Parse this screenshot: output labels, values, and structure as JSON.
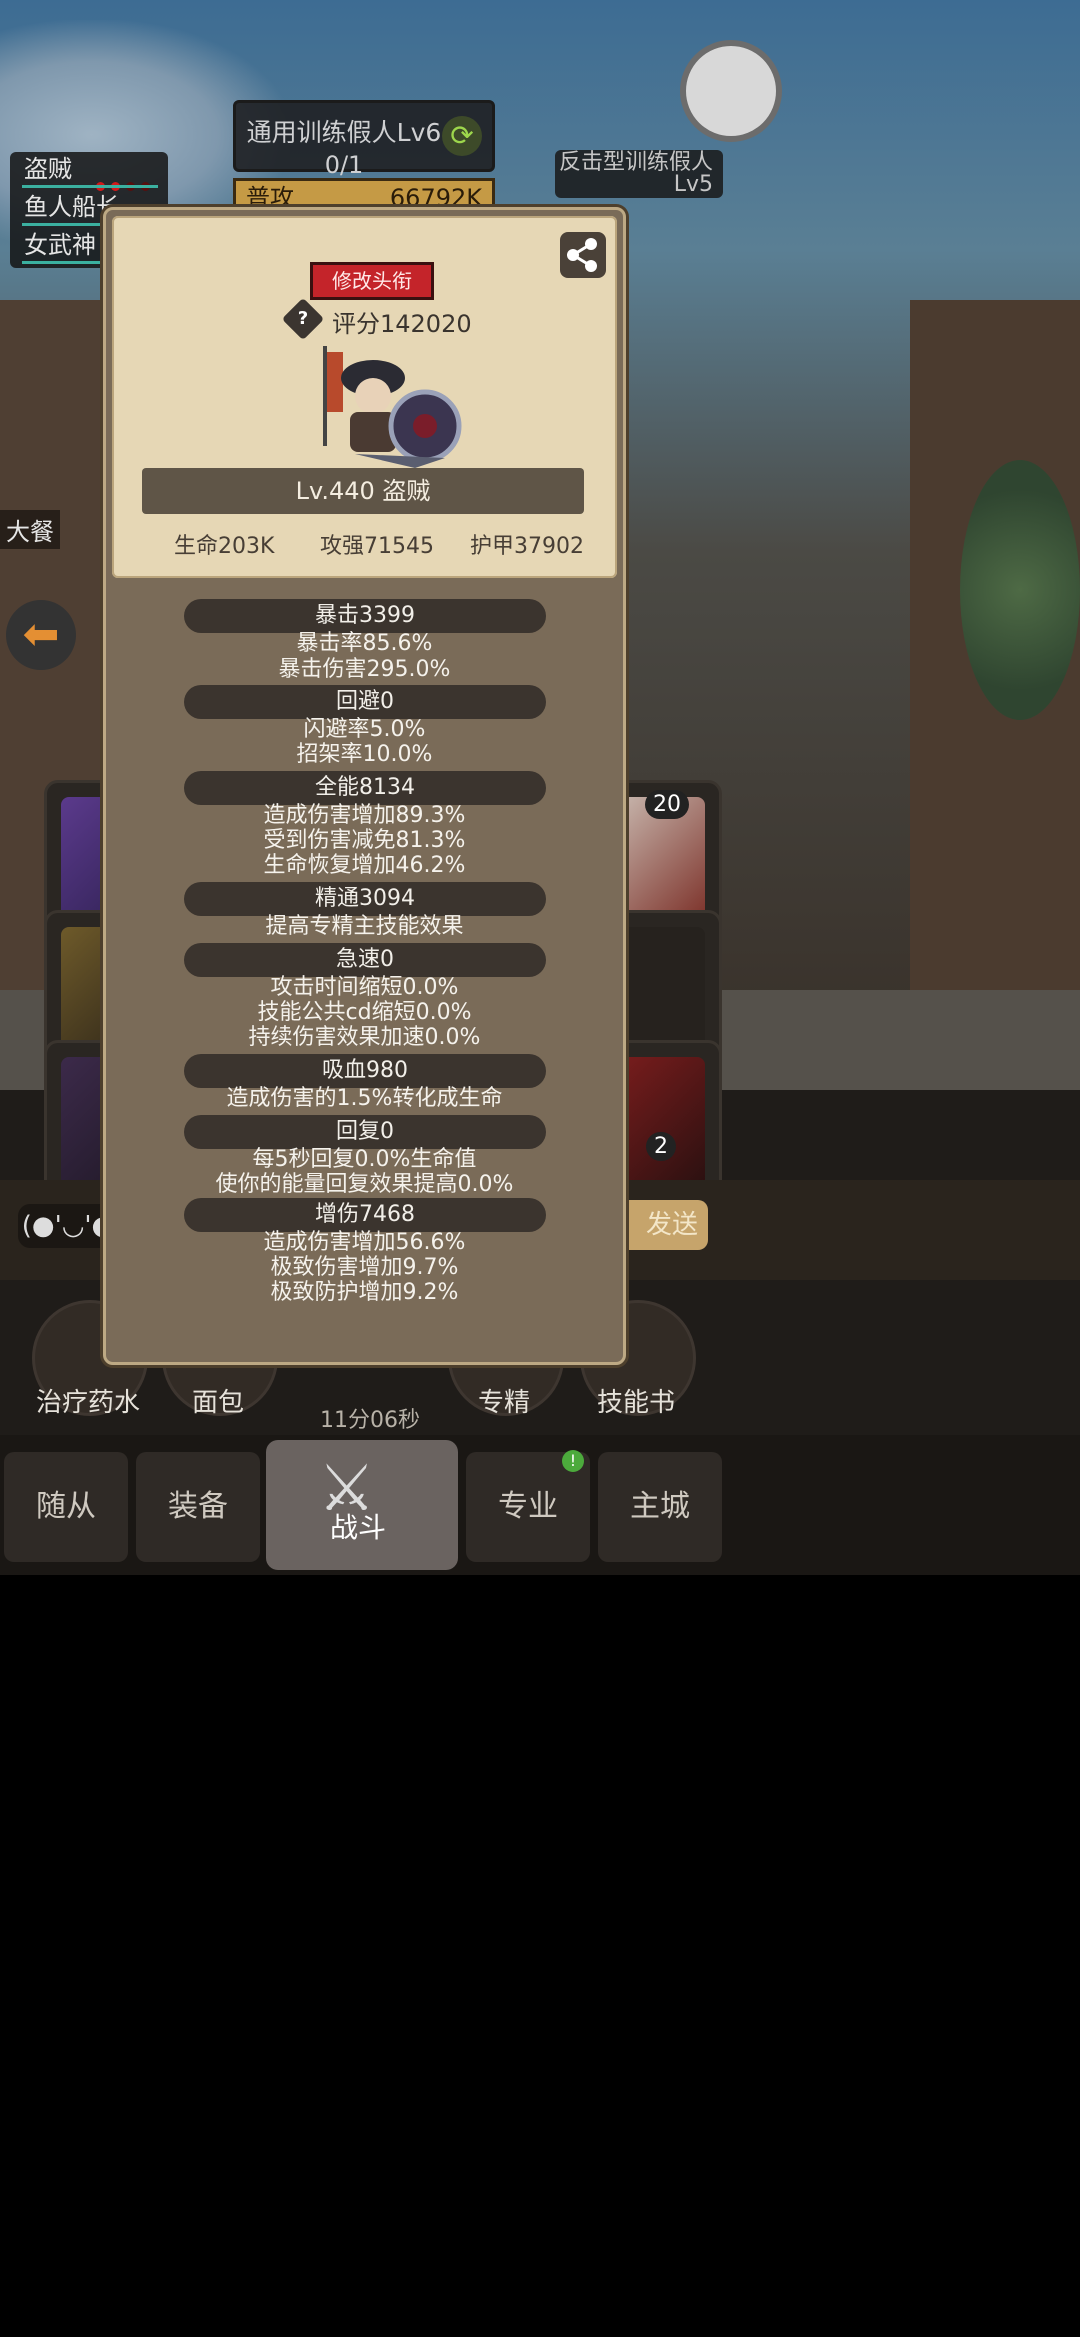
{
  "hud": {
    "target_name": "通用训练假人Lv6",
    "target_progress": "0/1",
    "attack_label": "普攻",
    "attack_value": "66792K",
    "right_target_line1": "反击型训练假人",
    "right_target_line2": "Lv5"
  },
  "party": [
    {
      "name": "盗贼"
    },
    {
      "name": "鱼人船长"
    },
    {
      "name": "女武神"
    }
  ],
  "side_label": "大餐",
  "modal": {
    "title_button": "修改头衔",
    "score": "评分142020",
    "level_name": "Lv.440 盗贼",
    "stats": {
      "hp": "生命203K",
      "attack": "攻强71545",
      "armor": "护甲37902"
    },
    "sections": [
      {
        "header": "暴击3399",
        "lines": [
          "暴击率85.6%",
          "暴击伤害295.0%"
        ]
      },
      {
        "header": "回避0",
        "lines": [
          "闪避率5.0%",
          "招架率10.0%"
        ]
      },
      {
        "header": "全能8134",
        "lines": [
          "造成伤害增加89.3%",
          "受到伤害减免81.3%",
          "生命恢复增加46.2%"
        ]
      },
      {
        "header": "精通3094",
        "lines": [
          "提高专精主技能效果"
        ]
      },
      {
        "header": "急速0",
        "lines": [
          "攻击时间缩短0.0%",
          "技能公共cd缩短0.0%",
          "持续伤害效果加速0.0%"
        ]
      },
      {
        "header": "吸血980",
        "lines": [
          "造成伤害的1.5%转化成生命"
        ]
      },
      {
        "header": "回复0",
        "lines": [
          "每5秒回复0.0%生命值",
          "使你的能量回复效果提高0.0%"
        ]
      },
      {
        "header": "增伤7468",
        "lines": [
          "造成伤害增加56.6%",
          "极致伤害增加9.7%",
          "极致防护增加9.2%"
        ]
      }
    ]
  },
  "slots": {
    "badge_top": "20",
    "badge_bottom": "2"
  },
  "chat": {
    "emoji": "(●'◡'●",
    "send": "发送"
  },
  "items": {
    "potion": "治疗药水",
    "bread": "面包",
    "specialty": "专精",
    "skillbook": "技能书",
    "timer": "11分06秒"
  },
  "tabs": {
    "followers": "随从",
    "equipment": "装备",
    "battle": "战斗",
    "profession": "专业",
    "main_city": "主城",
    "notify": "!"
  }
}
